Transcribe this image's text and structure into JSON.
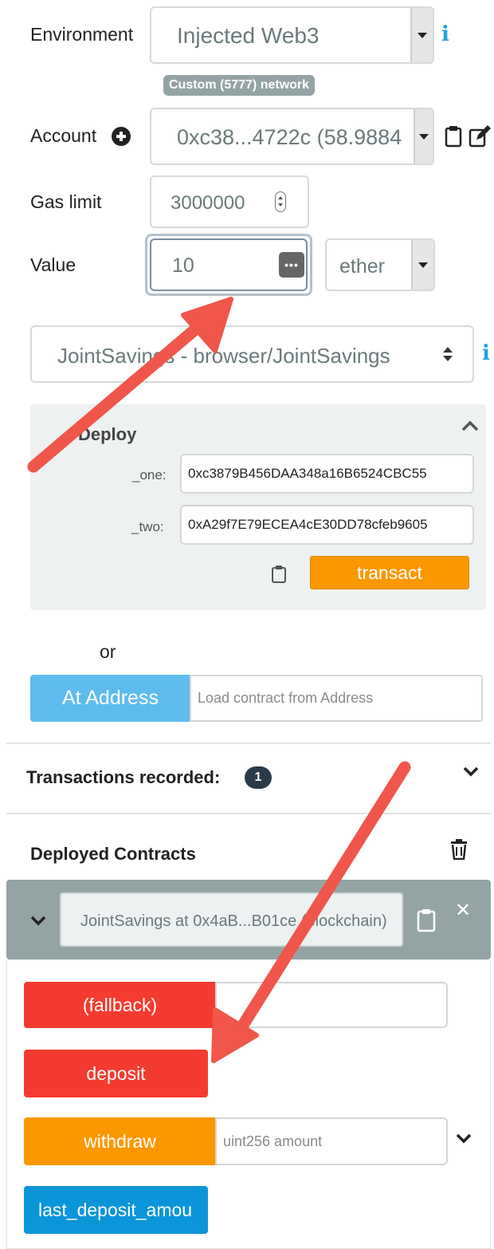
{
  "environment": {
    "label": "Environment",
    "value": "Injected Web3",
    "network_badge": "Custom (5777) network"
  },
  "account": {
    "label": "Account",
    "value": "0xc38...4722c (58.9884"
  },
  "gas_limit": {
    "label": "Gas limit",
    "value": "3000000"
  },
  "value_field": {
    "label": "Value",
    "value": "10",
    "unit": "ether"
  },
  "contract_select": {
    "value": "JointSavings - browser/JointSavings"
  },
  "deploy": {
    "title": "Deploy",
    "params": [
      {
        "name": "_one:",
        "value": "0xc3879B456DAA348a16B6524CBC55"
      },
      {
        "name": "_two:",
        "value": "0xA29f7E79ECEA4cE30DD78cfeb9605"
      }
    ],
    "transact_label": "transact"
  },
  "or_label": "or",
  "at_address": {
    "button_label": "At Address",
    "placeholder": "Load contract from Address"
  },
  "transactions": {
    "label": "Transactions recorded:",
    "count": "1"
  },
  "deployed": {
    "label": "Deployed Contracts",
    "instance_title": "JointSavings at 0x4aB...B01ce (blockchain)",
    "functions": [
      {
        "label": "(fallback)"
      },
      {
        "label": "deposit"
      },
      {
        "label": "withdraw",
        "placeholder": "uint256 amount"
      },
      {
        "label": "last_deposit_amou"
      }
    ]
  },
  "colors": {
    "payable_red": "#f43b30",
    "transact_orange": "#fb9800",
    "call_blue": "#0b95d9",
    "at_address_blue": "#5fbcee",
    "arrow": "#f0564a",
    "badge": "#94a4a4"
  },
  "icons": {
    "info": "info-icon",
    "add_account": "plus-circle-icon",
    "copy": "clipboard-icon",
    "edit": "edit-icon",
    "trash": "trash-icon",
    "close": "close-icon",
    "chevrons": "chevron-down-icon"
  }
}
